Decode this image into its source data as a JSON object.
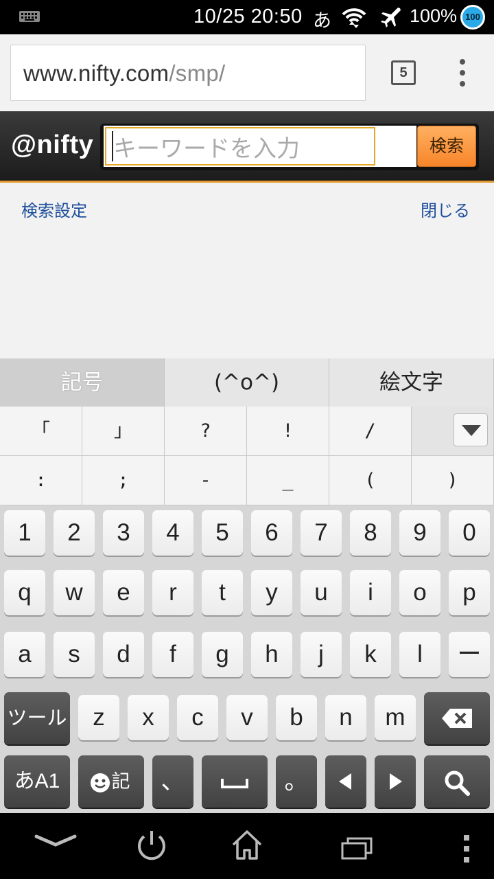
{
  "status_bar": {
    "time": "10/25 20:50",
    "ime_indicator": "あ",
    "battery": "100%",
    "badge": "100",
    "icons": [
      "keyboard-icon",
      "wifi-icon",
      "airplane-mode-icon"
    ]
  },
  "browser": {
    "url_host": "www.nifty.com",
    "url_path": "/smp/",
    "tab_count": "5"
  },
  "nifty": {
    "logo": "@nifty",
    "search_placeholder": "キーワードを入力",
    "search_button": "検索",
    "settings_link": "検索設定",
    "close_link": "閉じる",
    "accent_color": "#e39a2f"
  },
  "keyboard": {
    "category_tabs": [
      "記号",
      "(^o^)",
      "絵文字"
    ],
    "symbol_row1": [
      "「",
      "」",
      "?",
      "!",
      "/"
    ],
    "symbol_row2": [
      ":",
      ";",
      "-",
      "_",
      "(",
      ")"
    ],
    "number_row": [
      "1",
      "2",
      "3",
      "4",
      "5",
      "6",
      "7",
      "8",
      "9",
      "0"
    ],
    "qwerty_row1": [
      "q",
      "w",
      "e",
      "r",
      "t",
      "y",
      "u",
      "i",
      "o",
      "p"
    ],
    "qwerty_row2": [
      "a",
      "s",
      "d",
      "f",
      "g",
      "h",
      "j",
      "k",
      "l",
      "ー"
    ],
    "qwerty_row3": [
      "z",
      "x",
      "c",
      "v",
      "b",
      "n",
      "m"
    ],
    "tool_key": "ツール",
    "mode_key": "あA1",
    "emoji_key": "記",
    "comma_key": "、",
    "period_key": "。"
  }
}
